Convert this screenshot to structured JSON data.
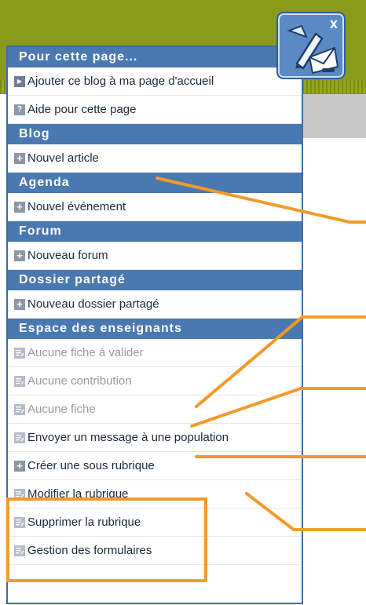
{
  "colors": {
    "header_bg": "#4a78b0",
    "olive_top": "#8a9a1a",
    "annotation": "#f39a2a",
    "text_disabled": "#9a9a9a"
  },
  "logo": {
    "icon": "pen-envelope-icon",
    "close_label": "x"
  },
  "sections": [
    {
      "title": "Pour cette page...",
      "items": [
        {
          "label": "Ajouter ce blog à ma page d'accueil",
          "icon": "arrow-icon",
          "disabled": false
        },
        {
          "label": "Aide pour cette page",
          "icon": "help-icon",
          "disabled": false
        }
      ]
    },
    {
      "title": "Blog",
      "items": [
        {
          "label": "Nouvel article",
          "icon": "plus-icon",
          "disabled": false
        }
      ]
    },
    {
      "title": "Agenda",
      "items": [
        {
          "label": "Nouvel événement",
          "icon": "plus-icon",
          "disabled": false
        }
      ]
    },
    {
      "title": "Forum",
      "items": [
        {
          "label": "Nouveau forum",
          "icon": "plus-icon",
          "disabled": false
        }
      ]
    },
    {
      "title": "Dossier partagé",
      "items": [
        {
          "label": "Nouveau dossier partagé",
          "icon": "plus-icon",
          "disabled": false
        }
      ]
    },
    {
      "title": "Espace des enseignants",
      "items": [
        {
          "label": "Aucune fiche à valider",
          "icon": "doc-icon",
          "disabled": true
        },
        {
          "label": "Aucune contribution",
          "icon": "doc-icon",
          "disabled": true
        },
        {
          "label": "Aucune fiche",
          "icon": "doc-icon",
          "disabled": true
        },
        {
          "label": "Envoyer un message à une population",
          "icon": "doc-icon",
          "disabled": false
        },
        {
          "label": "Créer une sous rubrique",
          "icon": "plus-icon",
          "disabled": false
        },
        {
          "label": "Modifier la rubrique",
          "icon": "doc-icon",
          "disabled": false
        },
        {
          "label": "Supprimer la rubrique",
          "icon": "doc-icon",
          "disabled": false
        },
        {
          "label": "Gestion des formulaires",
          "icon": "doc-icon",
          "disabled": false
        }
      ]
    }
  ]
}
